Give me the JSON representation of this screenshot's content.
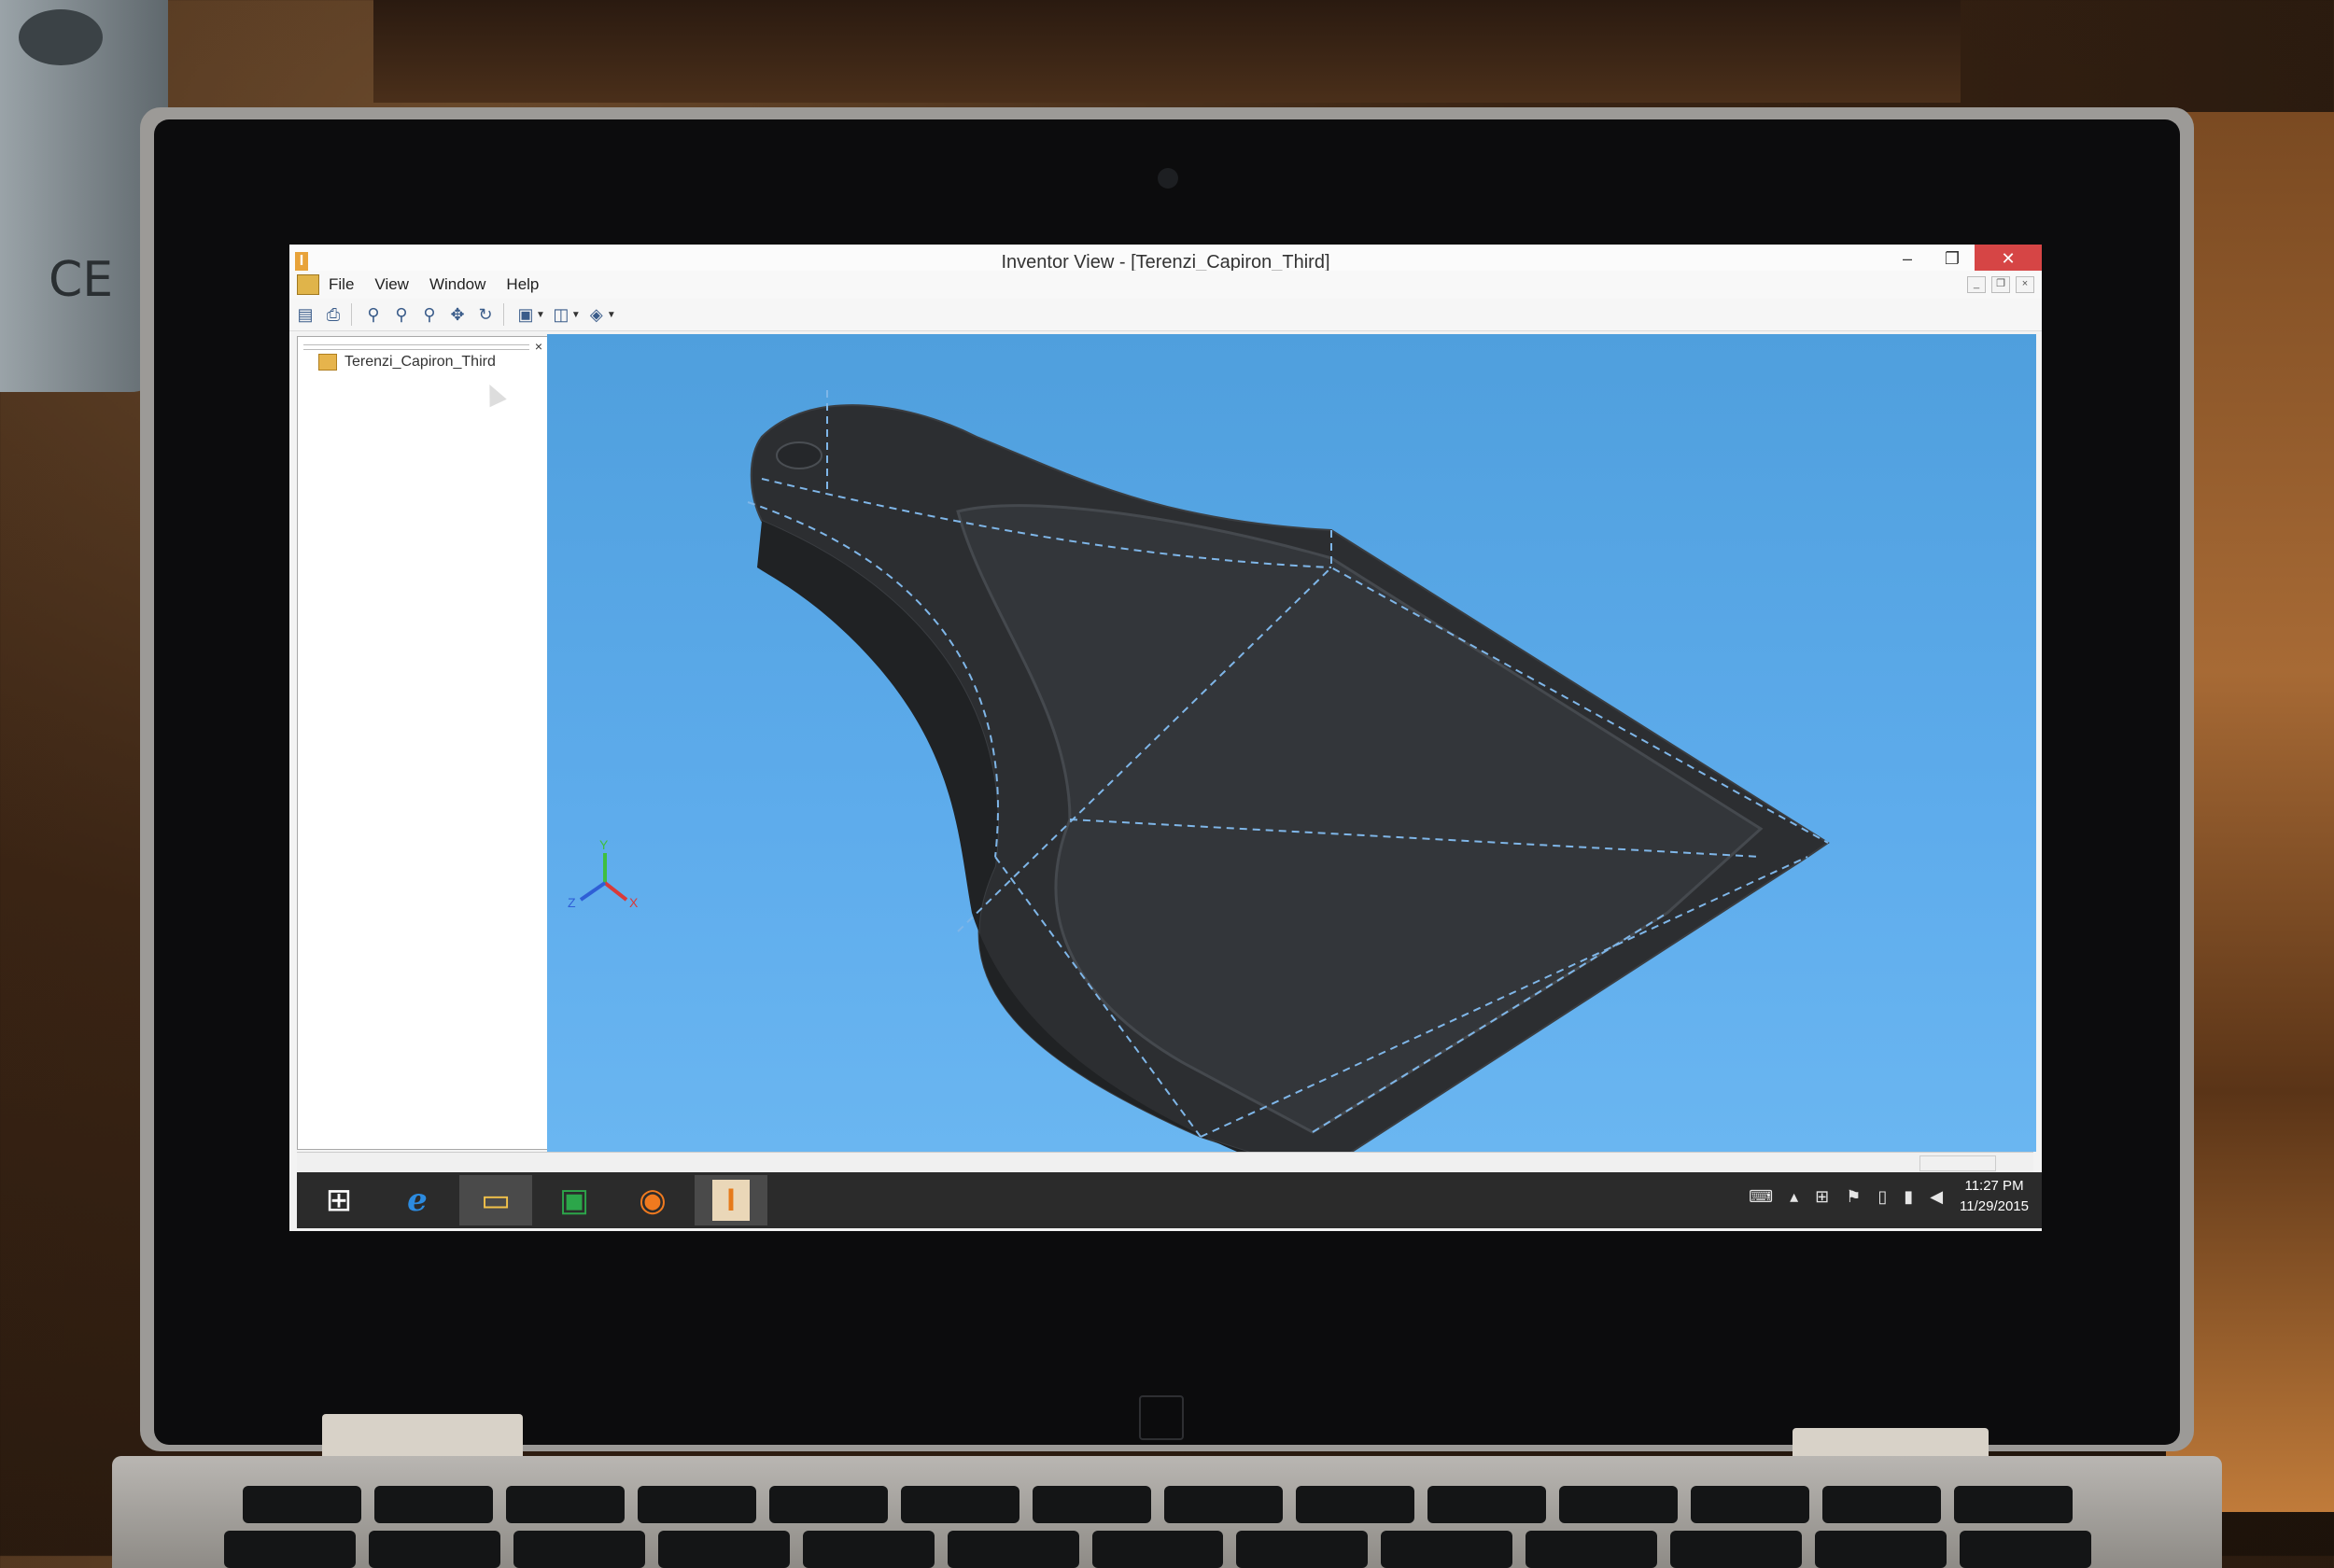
{
  "window": {
    "title": "Inventor View - [Terenzi_Capiron_Third]",
    "app_icon_glyph": "I",
    "min_glyph": "–",
    "restore_glyph": "❐",
    "close_glyph": "✕"
  },
  "menu": {
    "items": [
      "File",
      "View",
      "Window",
      "Help"
    ]
  },
  "mdi": {
    "min_glyph": "_",
    "restore_glyph": "❐",
    "close_glyph": "×"
  },
  "browser": {
    "close_glyph": "×",
    "tree_root_label": "Terenzi_Capiron_Third"
  },
  "viewcube_axes": {
    "x": "X",
    "y": "Y",
    "z": "Z"
  },
  "taskbar": {
    "time": "11:27 PM",
    "date": "11/29/2015"
  },
  "icons": {
    "toolbar": [
      "open-icon",
      "print-icon",
      "zoom-icon",
      "zoom-window-icon",
      "zoom-all-icon",
      "pan-icon",
      "orbit-icon",
      "view-style-icon",
      "display-mode-icon",
      "material-icon"
    ],
    "taskbar": [
      "windows-start-icon",
      "internet-explorer-icon",
      "file-explorer-icon",
      "store-icon",
      "firefox-icon",
      "inventor-icon"
    ],
    "tray": [
      "keyboard-icon",
      "show-hidden-icon",
      "action-center-icon",
      "flag-icon",
      "battery-icon",
      "network-icon",
      "volume-icon"
    ]
  },
  "colors": {
    "viewport_top": "#4f9fdd",
    "viewport_bottom": "#6ab6f1",
    "model": "#2b2d30",
    "model_edge": "#7fb6e8",
    "close": "#d64545",
    "taskbar": "#2b2b2b"
  }
}
